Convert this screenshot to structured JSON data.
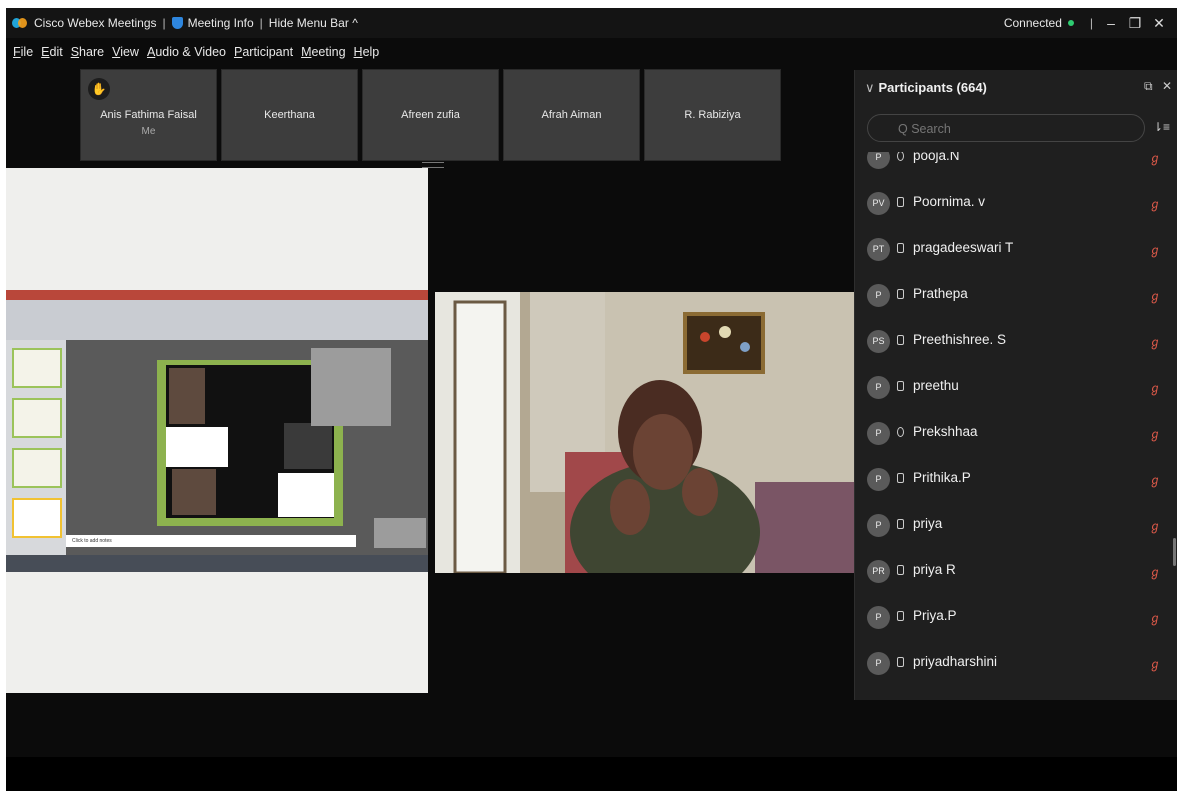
{
  "titlebar": {
    "app_name": "Cisco Webex Meetings",
    "meeting_info": "Meeting Info",
    "hide_menu": "Hide Menu Bar",
    "hide_menu_icon": "chevron-up-icon",
    "status": "Connected",
    "status_color": "#2ecc71"
  },
  "menu": [
    {
      "first": "F",
      "rest": "ile"
    },
    {
      "first": "E",
      "rest": "dit"
    },
    {
      "first": "S",
      "rest": "hare"
    },
    {
      "first": "V",
      "rest": "iew"
    },
    {
      "first": "A",
      "rest": "udio & Video"
    },
    {
      "first": "P",
      "rest": "articipant"
    },
    {
      "first": "M",
      "rest": "eeting"
    },
    {
      "first": "H",
      "rest": "elp"
    }
  ],
  "tiles": [
    {
      "name": "Anis Fathima Faisal",
      "sub": "Me",
      "icon": "raised-hand-icon"
    },
    {
      "name": "Keerthana"
    },
    {
      "name": "Afreen zufia"
    },
    {
      "name": "Afrah Aiman"
    },
    {
      "name": "R. Rabiziya"
    }
  ],
  "shared_content": {
    "notes_placeholder": "Click to add notes"
  },
  "participants": {
    "title": "Participants (664)",
    "search_placeholder": "Q Search",
    "search_label": "Q",
    "list": [
      {
        "initials": "P",
        "name": "pooja.N",
        "device": "mic"
      },
      {
        "initials": "PV",
        "name": "Poornima. v",
        "device": "phone"
      },
      {
        "initials": "PT",
        "name": "pragadeeswari T",
        "device": "phone"
      },
      {
        "initials": "P",
        "name": "Prathepa",
        "device": "phone"
      },
      {
        "initials": "PS",
        "name": "Preethishree. S",
        "device": "phone"
      },
      {
        "initials": "P",
        "name": "preethu",
        "device": "phone"
      },
      {
        "initials": "P",
        "name": "Prekshhaa",
        "device": "mic"
      },
      {
        "initials": "P",
        "name": "Prithika.P",
        "device": "phone"
      },
      {
        "initials": "P",
        "name": "priya",
        "device": "phone"
      },
      {
        "initials": "PR",
        "name": "priya R",
        "device": "phone"
      },
      {
        "initials": "P",
        "name": "Priya.P",
        "device": "phone"
      },
      {
        "initials": "P",
        "name": "priyadharshini",
        "device": "phone"
      }
    ],
    "mute_icon": "muted-mic-icon",
    "mute_color": "#e05a4a"
  }
}
